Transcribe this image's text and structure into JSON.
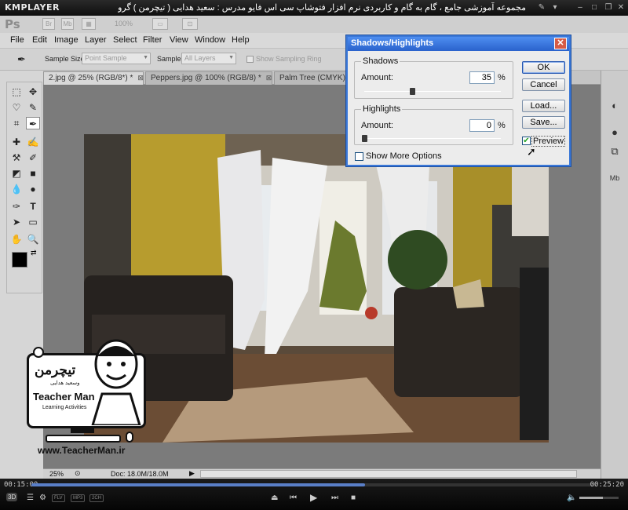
{
  "player": {
    "logo": "KMPLAYER",
    "caption": "مجموعه آموزشی جامع ، گام به گام و کاربردی نرم افزار فتوشاپ سی اس فایو  مدرس : سعید هدایی ( تیچرمن ) گروه آموزشی پادشاه گرافیست ها",
    "time_current": "00:15:00",
    "time_total": "00:25:20",
    "progress": 0.59,
    "volume": 0.6,
    "tags": [
      "FLV",
      "MP3",
      "2CH"
    ],
    "three_d": "3D"
  },
  "ps": {
    "logo": "Ps",
    "appbar_zoom": "100%",
    "menus": [
      "File",
      "Edit",
      "Image",
      "Layer",
      "Select",
      "Filter",
      "View",
      "Window",
      "Help"
    ],
    "options": {
      "sample_size_label": "Sample Size:",
      "sample_size_value": "Point Sample",
      "sample_label": "Sample:",
      "sample_value": "All Layers",
      "show_ring_label": "Show Sampling Ring"
    },
    "tabs": [
      {
        "label": "2.jpg @ 25% (RGB/8*) *",
        "active": true
      },
      {
        "label": "Peppers.jpg @ 100% (RGB/8) *",
        "active": false
      },
      {
        "label": "Palm Tree (CMYK).ti",
        "active": false
      }
    ],
    "status": {
      "zoom": "25%",
      "doc": "Doc: 18.0M/18.0M"
    }
  },
  "dialog": {
    "title": "Shadows/Highlights",
    "shadows": {
      "legend": "Shadows",
      "amount_label": "Amount:",
      "amount_value": "35",
      "unit": "%",
      "slider": 0.35
    },
    "highlights": {
      "legend": "Highlights",
      "amount_label": "Amount:",
      "amount_value": "0",
      "unit": "%",
      "slider": 0.0
    },
    "show_more_label": "Show More Options",
    "show_more_checked": false,
    "buttons": {
      "ok": "OK",
      "cancel": "Cancel",
      "load": "Load...",
      "save": "Save..."
    },
    "preview_label": "Preview",
    "preview_checked": true
  },
  "watermark": {
    "persian": "تیچرمن",
    "persian_sub": "وسعید هدایی",
    "name": "Teacher Man",
    "tagline": "Learning Activities",
    "url": "www.TeacherMan.ir"
  }
}
